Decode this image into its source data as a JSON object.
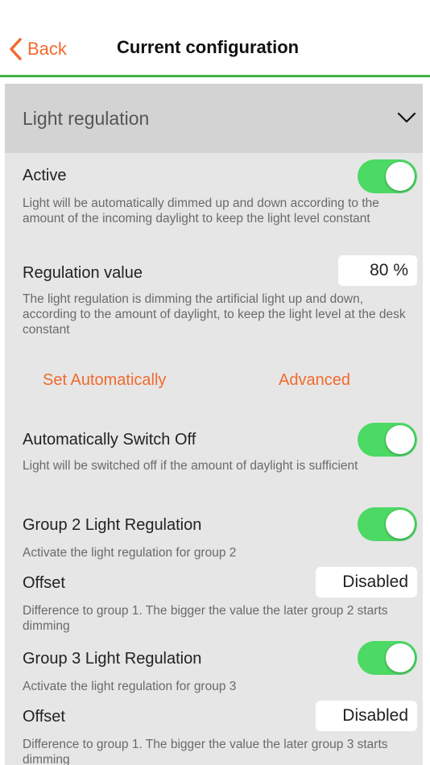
{
  "nav": {
    "back_label": "Back",
    "title": "Current configuration",
    "accent_color": "#f26a2e",
    "divider_color": "#3fb24a"
  },
  "section": {
    "title": "Light regulation",
    "expand_icon": "chevron-down-icon"
  },
  "active": {
    "label": "Active",
    "on": true,
    "description": "Light will be automatically dimmed up and down according to the amount of the incoming daylight to keep the light level constant"
  },
  "regulation": {
    "label": "Regulation value",
    "value": "80 %",
    "description": "The light regulation is dimming the artificial light up and down, according to the amount of daylight, to keep the light level at the desk constant"
  },
  "actions": {
    "set_automatically": "Set Automatically",
    "advanced": "Advanced"
  },
  "auto_off": {
    "label": "Automatically Switch Off",
    "on": true,
    "description": "Light will be switched off if the amount of daylight is sufficient"
  },
  "group2": {
    "label": "Group 2 Light Regulation",
    "on": true,
    "description": "Activate the light regulation for group 2",
    "offset_label": "Offset",
    "offset_value": "Disabled",
    "offset_description": "Difference to group 1. The bigger the value the later group 2 starts dimming"
  },
  "group3": {
    "label": "Group 3 Light Regulation",
    "on": true,
    "description": "Activate the light regulation for group 3",
    "offset_label": "Offset",
    "offset_value": "Disabled",
    "offset_description": "Difference to group 1. The bigger the value the later group 3 starts dimming"
  },
  "toggle_color": "#4cd964"
}
